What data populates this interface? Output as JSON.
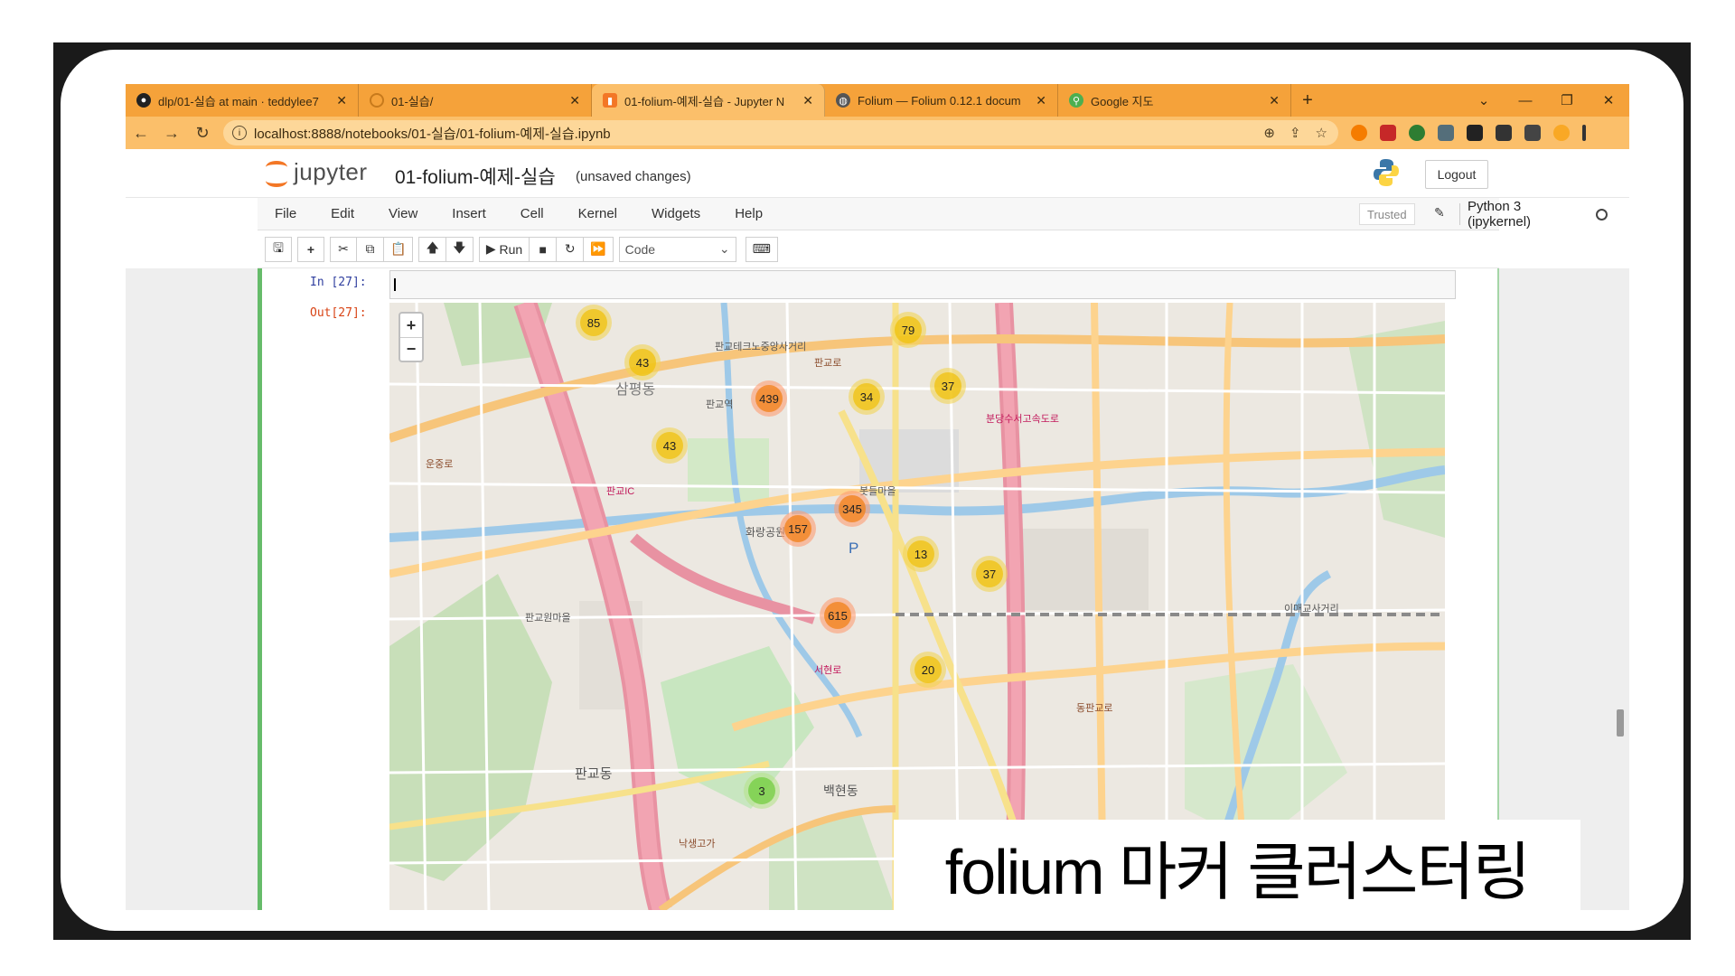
{
  "tabs": [
    {
      "label": "dlp/01-실습 at main · teddylee7",
      "icon": "github-icon",
      "active": false
    },
    {
      "label": "01-실습/",
      "icon": "loading-icon",
      "active": false
    },
    {
      "label": "01-folium-예제-실습 - Jupyter N",
      "icon": "jupyter-icon",
      "active": true
    },
    {
      "label": "Folium — Folium 0.12.1 docum",
      "icon": "globe-icon",
      "active": false
    },
    {
      "label": "Google 지도",
      "icon": "maps-icon",
      "active": false
    }
  ],
  "address": {
    "url": "localhost:8888/notebooks/01-실습/01-folium-예제-실습.ipynb"
  },
  "jupyter": {
    "logo_text": "jupyter",
    "notebook_name": "01-folium-예제-실습",
    "save_status": "(unsaved changes)",
    "logout_label": "Logout"
  },
  "menu": {
    "items": [
      "File",
      "Edit",
      "View",
      "Insert",
      "Cell",
      "Kernel",
      "Widgets",
      "Help"
    ],
    "trusted": "Trusted",
    "kernel": "Python 3 (ipykernel)"
  },
  "toolbar": {
    "run_label": "Run",
    "cell_type": "Code"
  },
  "cell": {
    "in_prompt": "In [27]:",
    "out_prompt": "Out[27]:"
  },
  "map": {
    "zoom_in": "+",
    "zoom_out": "−",
    "clusters": [
      {
        "count": "85",
        "size": "medium"
      },
      {
        "count": "43",
        "size": "medium"
      },
      {
        "count": "439",
        "size": "large"
      },
      {
        "count": "43",
        "size": "medium"
      },
      {
        "count": "79",
        "size": "medium"
      },
      {
        "count": "34",
        "size": "medium"
      },
      {
        "count": "37",
        "size": "medium"
      },
      {
        "count": "345",
        "size": "large"
      },
      {
        "count": "157",
        "size": "large"
      },
      {
        "count": "13",
        "size": "medium"
      },
      {
        "count": "37",
        "size": "medium"
      },
      {
        "count": "615",
        "size": "large"
      },
      {
        "count": "20",
        "size": "medium"
      },
      {
        "count": "3",
        "size": "small"
      }
    ],
    "labels": [
      "삼평동",
      "판교동",
      "화랑공원",
      "판교IC",
      "백현동",
      "판교테크노중앙사거리",
      "판교로",
      "동판교로",
      "서현로",
      "분당수서고속도로",
      "낙생고가",
      "판교원마을",
      "봇들마을",
      "이매교사거리",
      "운중로",
      "판교역",
      "P"
    ]
  },
  "caption": {
    "text": "folium 마커 클러스터링"
  }
}
